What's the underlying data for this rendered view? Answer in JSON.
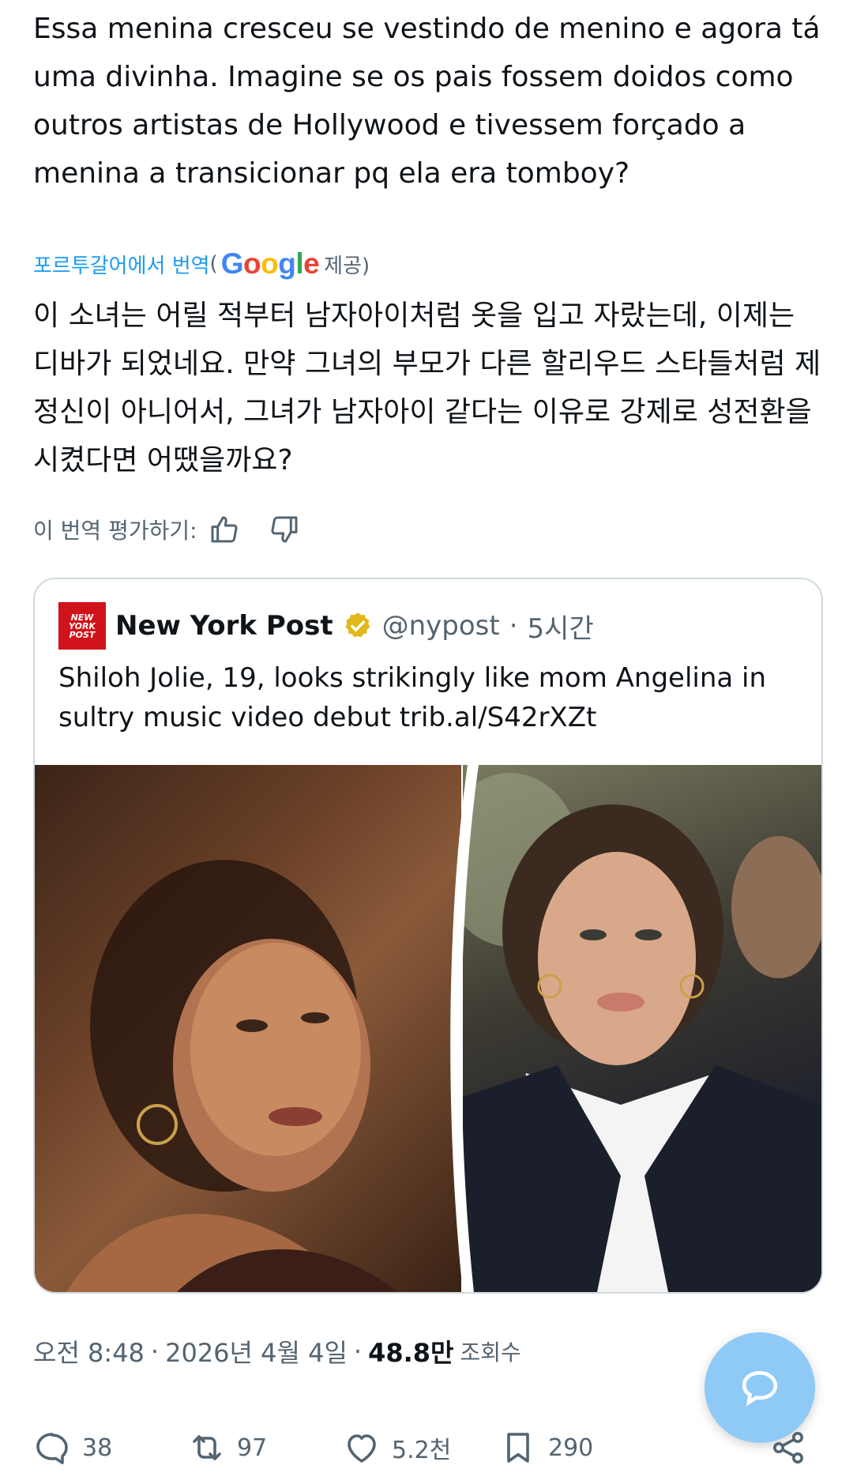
{
  "tweet": {
    "text": "Essa menina cresceu se vestindo de menino e agora tá uma divinha. Imagine se os pais fossem doidos como outros artistas de Hollywood e tivessem forçado a menina a transicionar pq ela era tomboy?",
    "translate_link": "포르투갈어에서 번역",
    "translate_paren_open": "(",
    "google_brand": "Google",
    "translate_provided": "제공)",
    "translated_text": "이 소녀는 어릴 적부터 남자아이처럼 옷을 입고 자랐는데, 이제는 디바가 되었네요. 만약 그녀의 부모가 다른 할리우드 스타들처럼 제정신이 아니어서, 그녀가 남자아이 같다는 이유로 강제로 성전환을 시켰다면 어땠을까요?",
    "rate_label": "이 번역 평가하기:"
  },
  "quote": {
    "logo_text": "NEW YORK POST",
    "name": "New York Post",
    "handle": "@nypost",
    "sep": "·",
    "time": "5시간",
    "text": "Shiloh Jolie, 19, looks strikingly like mom Angelina in sultry music video debut trib.al/S42rXZt"
  },
  "meta": {
    "time": "오전 8:48",
    "sep1": "·",
    "date": "2026년 4월 4일",
    "sep2": "·",
    "views": "48.8만",
    "views_label": "조회수"
  },
  "actions": {
    "replies": "38",
    "reposts": "97",
    "likes": "5.2천",
    "bookmarks": "290"
  },
  "colors": {
    "accent": "#1d9bf0",
    "verified_gold": "#e2b719",
    "nyp_red": "#d0121a",
    "fab": "#8fcaf7"
  }
}
